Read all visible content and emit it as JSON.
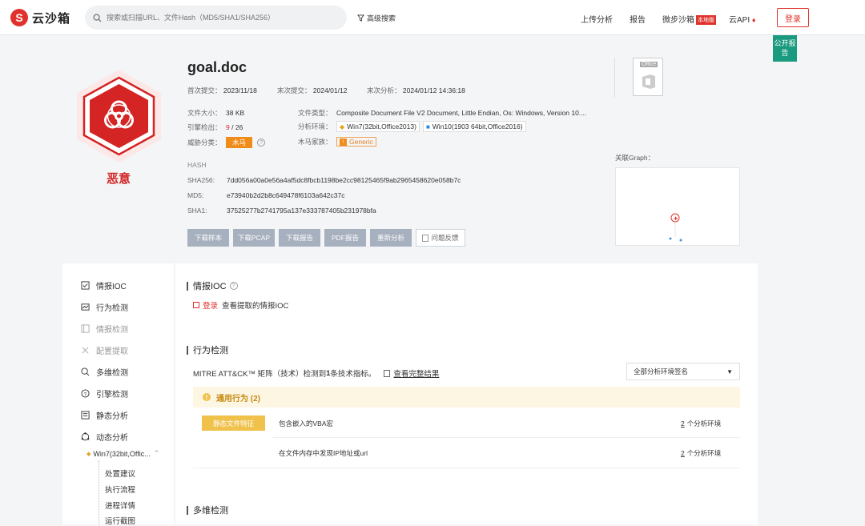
{
  "header": {
    "logo_text": "云沙箱",
    "search_placeholder": "搜索或扫描URL、文件Hash（MD5/SHA1/SHA256）",
    "advanced_search": "高级搜索",
    "nav": {
      "upload": "上传分析",
      "report": "报告",
      "micro_sandbox": "微步沙箱",
      "local_badge": "本地版",
      "cloud_api": "云API",
      "login": "登录"
    },
    "public_report": "公开报告"
  },
  "file": {
    "name": "goal.doc",
    "verdict": "恶意",
    "first_submit_label": "首次提交：",
    "first_submit": "2023/11/18",
    "last_submit_label": "末次提交：",
    "last_submit": "2024/01/12",
    "last_analysis_label": "末次分析：",
    "last_analysis": "2024/01/12 14:36:18",
    "size_label": "文件大小：",
    "size": "38 KB",
    "type_label": "文件类型：",
    "type": "Composite Document File V2 Document, Little Endian, Os: Windows, Version 10....",
    "engine_label": "引擎检出：",
    "engine_hits": "9",
    "engine_sep": " / ",
    "engine_total": "26",
    "env_label": "分析环境：",
    "env1": "Win7(32bit,Office2013)",
    "env2": "Win10(1903 64bit,Office2016)",
    "threat_label": "威胁分类：",
    "threat": "木马",
    "family_label": "木马家族：",
    "family": "Generic",
    "office_label": "Office"
  },
  "hash": {
    "title": "HASH",
    "sha256_label": "SHA256:",
    "sha256": "7dd056a00a0e56a4af5dc8fbcb1198be2cc98125465f9ab2965458620e058b7c",
    "md5_label": "MD5:",
    "md5": "e73940b2d2b8c649478f6103a642c37c",
    "sha1_label": "SHA1:",
    "sha1": "37525277b2741795a137e333787405b231978bfa"
  },
  "actions": {
    "download_sample": "下载样本",
    "download_pcap": "下载PCAP",
    "download_report": "下载报告",
    "pdf_report": "PDF报告",
    "reanalyze": "重新分析",
    "feedback": "问题反馈"
  },
  "graph": {
    "title": "关联Graph："
  },
  "sidebar": {
    "items": [
      {
        "label": "情报IOC",
        "icon": "intel-icon"
      },
      {
        "label": "行为检测",
        "icon": "behavior-icon"
      },
      {
        "label": "情报检测",
        "icon": "intel-detect-icon"
      },
      {
        "label": "配置提取",
        "icon": "config-icon"
      },
      {
        "label": "多维检测",
        "icon": "multi-icon"
      },
      {
        "label": "引擎检测",
        "icon": "engine-icon"
      },
      {
        "label": "静态分析",
        "icon": "static-icon"
      },
      {
        "label": "动态分析",
        "icon": "dynamic-icon"
      }
    ],
    "env_node": "Win7(32bit,Offic...",
    "sub_items": [
      "处置建议",
      "执行流程",
      "进程详情",
      "运行截图"
    ]
  },
  "ioc": {
    "title": "情报IOC",
    "login_link": "登录",
    "login_text": "查看提取的情报IOC"
  },
  "behavior": {
    "title": "行为检测",
    "mitre_prefix": "MITRE ATT&CK™ 矩阵（技术）检测到 ",
    "mitre_count": "1",
    "mitre_suffix": " 条技术指标。",
    "view_full": "查看完整结果",
    "env_select": "全部分析环境签名",
    "general_title": "通用行为 (2)",
    "static_tag": "静态文件特征",
    "rows": [
      {
        "text": "包含嵌入的VBA宏",
        "env_count": "2",
        "env_text": "个分析环境"
      },
      {
        "text": "在文件内存中发现IP地址或url",
        "env_count": "2",
        "env_text": "个分析环境"
      }
    ]
  },
  "multi": {
    "title": "多维检测"
  }
}
